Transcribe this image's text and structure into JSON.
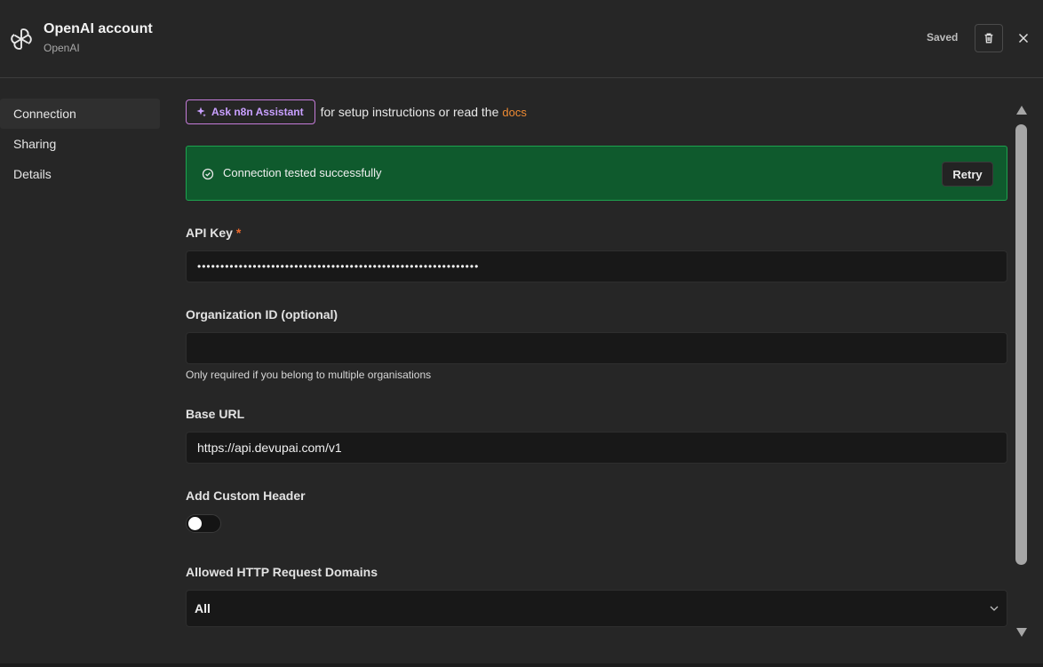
{
  "header": {
    "title": "OpenAI account",
    "subtitle": "OpenAI",
    "status": "Saved",
    "logo_icon": "openai-logo-icon",
    "delete_icon": "trash-icon",
    "close_icon": "close-icon"
  },
  "sidebar": {
    "items": [
      {
        "label": "Connection",
        "active": true
      },
      {
        "label": "Sharing",
        "active": false
      },
      {
        "label": "Details",
        "active": false
      }
    ]
  },
  "assistant": {
    "button_label": "Ask n8n Assistant",
    "text": "for setup instructions or read the",
    "docs_link": "docs"
  },
  "alert": {
    "message": "Connection tested successfully",
    "retry_label": "Retry"
  },
  "fields": {
    "api_key": {
      "label": "API Key",
      "required_marker": "*",
      "value": "•••••••••••••••••••••••••••••••••••••••••••••••••••••••••••••"
    },
    "organization_id": {
      "label": "Organization ID (optional)",
      "value": "",
      "hint": "Only required if you belong to multiple organisations"
    },
    "base_url": {
      "label": "Base URL",
      "value": "https://api.devupai.com/v1"
    },
    "custom_header": {
      "label": "Add Custom Header",
      "enabled": false
    },
    "allowed_domains": {
      "label": "Allowed HTTP Request Domains",
      "selected": "All"
    }
  },
  "colors": {
    "background": "#262626",
    "success_bg": "#0f5a2d",
    "success_border": "#1da34f",
    "assistant_accent": "#c9a0ff",
    "link": "#ee8a33",
    "required": "#ee6a2c"
  }
}
